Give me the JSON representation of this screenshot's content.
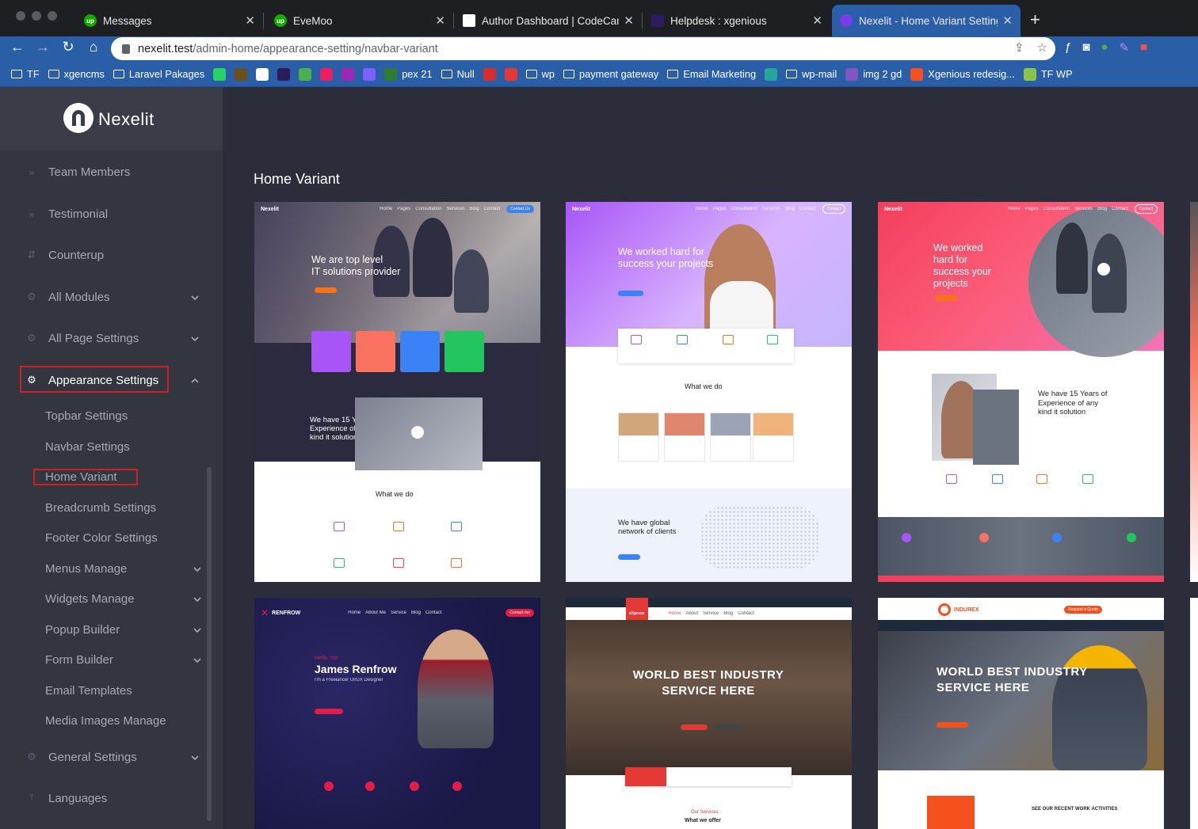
{
  "browser": {
    "tabs": [
      {
        "title": "Messages",
        "favicon": "upwork-icon",
        "color": "#14a800"
      },
      {
        "title": "EveMoo",
        "favicon": "upwork-icon",
        "color": "#14a800"
      },
      {
        "title": "Author Dashboard | CodeCanyo",
        "favicon": "codecanyon-icon",
        "color": "#ffffff"
      },
      {
        "title": "Helpdesk : xgenious",
        "favicon": "helpdesk-icon",
        "color": "#2d1b5e"
      },
      {
        "title": "Nexelit - Home Variant Setting",
        "favicon": "nexelit-icon",
        "color": "#7c3aed"
      }
    ],
    "url_host": "nexelit.test",
    "url_path": "/admin-home/appearance-setting/navbar-variant",
    "bookmarks": [
      {
        "label": "TF",
        "type": "folder"
      },
      {
        "label": "xgencms",
        "type": "folder"
      },
      {
        "label": "Laravel Pakages",
        "type": "folder"
      },
      {
        "label": "",
        "type": "icon",
        "color": "#25d366"
      },
      {
        "label": "",
        "type": "icon",
        "color": "#6b4f1d"
      },
      {
        "label": "",
        "type": "icon",
        "color": "#ffffff"
      },
      {
        "label": "",
        "type": "icon",
        "color": "#2d1b5e"
      },
      {
        "label": "",
        "type": "icon",
        "color": "#4caf50"
      },
      {
        "label": "",
        "type": "icon",
        "color": "#e91e63"
      },
      {
        "label": "",
        "type": "icon",
        "color": "#9c27b0"
      },
      {
        "label": "",
        "type": "icon",
        "color": "#7b61ff"
      },
      {
        "label": "pex 21",
        "type": "icon",
        "color": "#2e7d32"
      },
      {
        "label": "Null",
        "type": "folder"
      },
      {
        "label": "",
        "type": "icon",
        "color": "#d32f2f"
      },
      {
        "label": "",
        "type": "icon",
        "color": "#e53935"
      },
      {
        "label": "wp",
        "type": "folder"
      },
      {
        "label": "payment gateway",
        "type": "folder"
      },
      {
        "label": "Email Marketing",
        "type": "folder"
      },
      {
        "label": "",
        "type": "icon",
        "color": "#26a69a"
      },
      {
        "label": "wp-mail",
        "type": "folder"
      },
      {
        "label": "img 2 gd",
        "type": "icon",
        "color": "#7e57c2"
      },
      {
        "label": "Xgenious redesig...",
        "type": "icon",
        "color": "#f4511e"
      },
      {
        "label": "TF WP",
        "type": "icon",
        "color": "#8bc34a"
      }
    ]
  },
  "app": {
    "logo_text": "Nexelit",
    "sidebar": {
      "items": [
        {
          "label": "Team Members",
          "icon": "double-chevron-icon",
          "has_children": false
        },
        {
          "label": "Testimonial",
          "icon": "double-chevron-icon",
          "has_children": false
        },
        {
          "label": "Counterup",
          "icon": "arrows-icon",
          "has_children": false
        },
        {
          "label": "All Modules",
          "icon": "gear-icon",
          "has_children": true
        },
        {
          "label": "All Page Settings",
          "icon": "gear-icon",
          "has_children": true
        },
        {
          "label": "Appearance Settings",
          "icon": "gear-icon",
          "has_children": true,
          "expanded": true
        }
      ],
      "sub_items": [
        {
          "label": "Topbar Settings",
          "has_children": false
        },
        {
          "label": "Navbar Settings",
          "has_children": false
        },
        {
          "label": "Home Variant",
          "has_children": false,
          "active": true
        },
        {
          "label": "Breadcrumb Settings",
          "has_children": false
        },
        {
          "label": "Footer Color Settings",
          "has_children": false
        },
        {
          "label": "Menus Manage",
          "has_children": true
        },
        {
          "label": "Widgets Manage",
          "has_children": true
        },
        {
          "label": "Popup Builder",
          "has_children": true
        },
        {
          "label": "Form Builder",
          "has_children": true
        },
        {
          "label": "Email Templates",
          "has_children": false
        },
        {
          "label": "Media Images Manage",
          "has_children": false
        }
      ],
      "bottom_items": [
        {
          "label": "General Settings",
          "icon": "gear-icon",
          "has_children": true
        },
        {
          "label": "Languages",
          "icon": "translate-icon",
          "has_children": false
        }
      ]
    },
    "page_title": "Home Variant",
    "variants": [
      {
        "brand": "Nexelit",
        "headline_1": "We are top level",
        "headline_2": "IT solutions provider",
        "section_1": "We have 15 Years of",
        "section_2": "Experience of any",
        "section_3": "kind it solution",
        "section_4": "What we do",
        "accent": "#3b82f6"
      },
      {
        "brand": "Nexelit",
        "headline_1": "We worked hard for",
        "headline_2": "success your projects",
        "section_1": "What we do",
        "section_2": "We have global",
        "section_3": "network of clients",
        "accent": "#a855f7"
      },
      {
        "brand": "Nexelit",
        "headline_1": "We worked",
        "headline_2": "hard for",
        "headline_3": "success your",
        "headline_4": "projects",
        "section_1": "We have 15 Years of",
        "section_2": "Experience of any",
        "section_3": "kind it solution",
        "accent": "#f43f5e"
      },
      {
        "brand": "RENFROW",
        "greeting": "Hello, I'm",
        "name": "James Renfrow",
        "role": "I'm a Freelancer UI/UX Designer",
        "accent": "#e11d48"
      },
      {
        "brand": "eXpress",
        "headline_1": "WORLD BEST INDUSTRY",
        "headline_2": "SERVICE HERE",
        "section_1": "What we offer",
        "accent": "#e53935"
      },
      {
        "brand": "INDUREX",
        "headline_1": "WORLD BEST INDUSTRY",
        "headline_2": "SERVICE HERE",
        "section_1": "SEE OUR RECENT WORK ACTIVITIES",
        "accent": "#f4511e"
      }
    ]
  }
}
